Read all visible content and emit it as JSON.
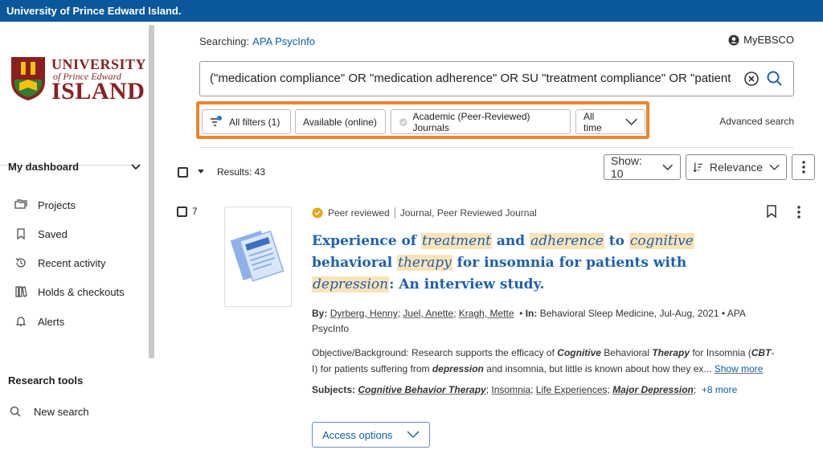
{
  "topbar": {
    "title": "University of Prince Edward Island."
  },
  "logo": {
    "line1": "UNIVERSITY",
    "line2": "of Prince Edward",
    "line3": "ISLAND"
  },
  "sidebar": {
    "dashboard_label": "My dashboard",
    "items": [
      {
        "label": "Projects",
        "icon": "folders-icon"
      },
      {
        "label": "Saved",
        "icon": "bookmark-icon"
      },
      {
        "label": "Recent activity",
        "icon": "history-icon"
      },
      {
        "label": "Holds & checkouts",
        "icon": "books-icon"
      },
      {
        "label": "Alerts",
        "icon": "bell-icon"
      }
    ],
    "research_tools_label": "Research tools",
    "new_search_label": "New search"
  },
  "search": {
    "searching_label": "Searching:",
    "database": "APA PsycInfo",
    "query": "(\"medication compliance\" OR \"medication adherence\" OR SU \"treatment compliance\" OR \"patient compl",
    "myebsco": "MyEBSCO"
  },
  "filters": {
    "all_filters": "All filters (1)",
    "available": "Available (online)",
    "peer_reviewed": "Academic (Peer-Reviewed) Journals",
    "all_time": "All time",
    "advanced": "Advanced search"
  },
  "results_bar": {
    "results": "Results: 43",
    "show": "Show: 10",
    "sort": "Relevance"
  },
  "result": {
    "number": "7",
    "peer": "Peer reviewed",
    "type": "Journal, Peer Reviewed Journal",
    "title_parts": {
      "t1": "Experience of ",
      "h1": "treatment",
      "t2": " and ",
      "h2": "adherence",
      "t3": " to ",
      "h3": "cognitive",
      "t4": " behavioral ",
      "h4": "therapy",
      "t5": " for insomnia for patients with ",
      "h5": "depression",
      "t6": ": An interview study."
    },
    "by_label": "By:",
    "authors": [
      "Dyrberg, Henny",
      "Juel, Anette",
      "Kragh, Mette"
    ],
    "in_label": "In:",
    "source": "Behavioral Sleep Medicine, Jul-Aug, 2021 • APA PsycInfo",
    "abstract_parts": {
      "a1": "Objective/Background: Research supports the efficacy of ",
      "b1": "Cognitive",
      "a2": " Behavioral ",
      "b2": "Therapy",
      "a3": " for Insomnia (",
      "b3": "CBT",
      "a4": "-I) for patients suffering from ",
      "b4": "depression",
      "a5": " and insomnia, but little is known about how they ex...",
      "more": "Show more"
    },
    "subjects_label": "Subjects:",
    "subjects": [
      "Cognitive Behavior Therapy",
      "Insomnia",
      "Life Experiences",
      "Major Depression"
    ],
    "subjects_more": "+8 more",
    "access": "Access options"
  }
}
